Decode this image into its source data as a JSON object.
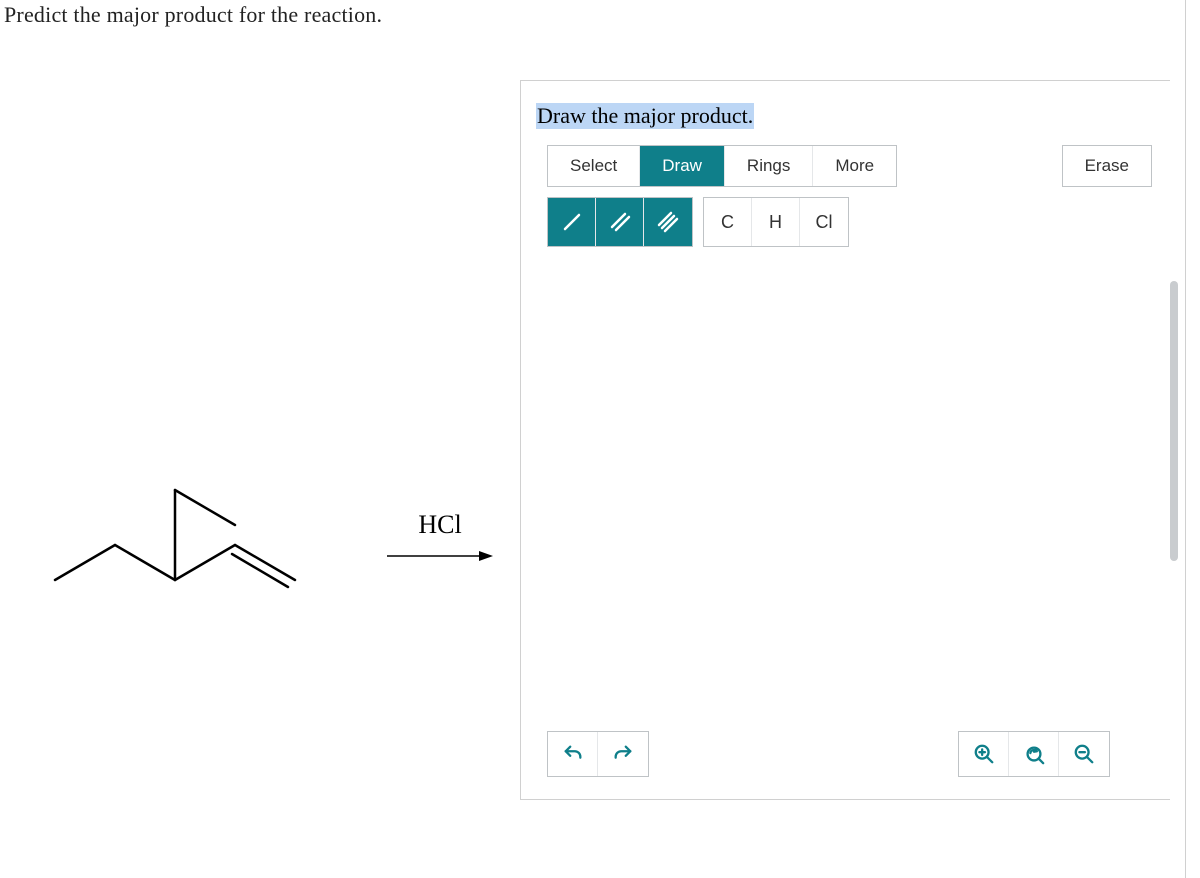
{
  "question": "Predict the major product for the reaction.",
  "reagent": "HCl",
  "editor": {
    "title": "Draw the major product.",
    "tabs": {
      "select": "Select",
      "draw": "Draw",
      "rings": "Rings",
      "more": "More"
    },
    "erase": "Erase",
    "bonds": {
      "single": "/",
      "double": "//",
      "triple": "///"
    },
    "atoms": {
      "c": "C",
      "h": "H",
      "cl": "Cl"
    }
  }
}
